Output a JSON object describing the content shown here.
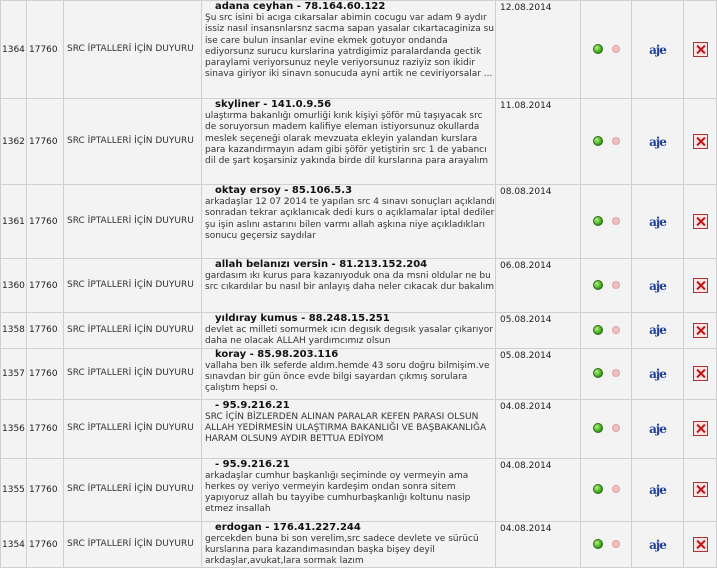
{
  "comments": [
    {
      "comment_id": "1364",
      "news_id": "17760",
      "subject": "SRC İPTALLERİ İÇİN DUYURU",
      "author": "adana ceyhan",
      "ip": "78.164.60.122",
      "date": "12.08.2014",
      "text": "Şu src isini bi acıga cıkarsalar abimin cocugu var adam 9 aydır issiz nasıl insansnlarsnz sacma sapan yasalar cıkartacaginiza su ise care bulun insanlar evine ekmek gotuyor ondanda ediyorsunz surucu kurslarina yatrdigimiz paralardanda gectik paraylami veriyorsunuz neyle veriyorsunuz raziyiz son ikidir sinava giriyor iki sinavn sonucuda ayni artik ne ceviriyorsalar ..."
    },
    {
      "comment_id": "1362",
      "news_id": "17760",
      "subject": "SRC İPTALLERİ İÇİN DUYURU",
      "author": "skyliner",
      "ip": "141.0.9.56",
      "date": "11.08.2014",
      "text": "ulaştırma bakanlığı omurliği kırık kişiyi şöför mü taşıyacak src de soruyorsun madem kalifiye eleman istiyorsunuz okullarda meslek seçeneği olarak mevzuata ekleyin yalandan kurslara para kazandırmayın adam gibi şöför yetiştirin src 1 de yabancı dil de şart koşarsiniz yakında birde dil kurslarına para arayalım"
    },
    {
      "comment_id": "1361",
      "news_id": "17760",
      "subject": "SRC İPTALLERİ İÇİN DUYURU",
      "author": "oktay ersoy",
      "ip": "85.106.5.3",
      "date": "08.08.2014",
      "text": "arkadaşlar 12 07 2014 te yapılan src 4 sınavı sonuçları açıklandı sonradan tekrar açıklanıcak dedi kurs o açıklamalar iptal dediler şu işin aslını astarını bilen varmı allah aşkına niye açıkladıkları sonucu geçersiz saydılar"
    },
    {
      "comment_id": "1360",
      "news_id": "17760",
      "subject": "SRC İPTALLERİ İÇİN DUYURU",
      "author": "allah belanızı versin",
      "ip": "81.213.152.204",
      "date": "06.08.2014",
      "text": "gardasım ıkı kurus para kazanıyoduk ona da msni oldular ne bu src cıkardılar bu nasıl bir anlayış daha neler cıkacak dur bakalım"
    },
    {
      "comment_id": "1358",
      "news_id": "17760",
      "subject": "SRC İPTALLERİ İÇİN DUYURU",
      "author": "yıldıray kumus",
      "ip": "88.248.15.251",
      "date": "05.08.2014",
      "text": "devlet ac milleti somurmek ıcın degısık degısık yasalar çıkarıyor daha ne olacak ALLAH yardımcımız olsun"
    },
    {
      "comment_id": "1357",
      "news_id": "17760",
      "subject": "SRC İPTALLERİ İÇİN DUYURU",
      "author": "koray",
      "ip": "85.98.203.116",
      "date": "05.08.2014",
      "text": "vallaha ben ilk seferde aldım.hemde 43 soru doğru bilmişim.ve sınavdan bir gün önce evde bilgi sayardan çıkmış sorulara çalıştım hepsi o."
    },
    {
      "comment_id": "1356",
      "news_id": "17760",
      "subject": "SRC İPTALLERİ İÇİN DUYURU",
      "author": "",
      "ip": "95.9.216.21",
      "date": "04.08.2014",
      "text": "SRC İÇİN BİZLERDEN ALINAN PARALAR KEFEN PARASI OLSUN ALLAH YEDİRMESİN ULAŞTIRMA BAKANLIĞI VE BAŞBAKANLIĞA HARAM OLSUN9 AYDIR BETTUA EDİYOM"
    },
    {
      "comment_id": "1355",
      "news_id": "17760",
      "subject": "SRC İPTALLERİ İÇİN DUYURU",
      "author": "",
      "ip": "95.9.216.21",
      "date": "04.08.2014",
      "text": "arkadaşlar cumhur başkanlığı seçiminde oy vermeyin ama herkes oy veriyo vermeyin kardeşim ondan sonra sitem yapıyoruz allah bu tayyibe cumhurbaşkanlığı koltunu nasip etmez insallah"
    },
    {
      "comment_id": "1354",
      "news_id": "17760",
      "subject": "SRC İPTALLERİ İÇİN DUYURU",
      "author": "erdogan",
      "ip": "176.41.227.244",
      "date": "04.08.2014",
      "text": "gercekden buna bi son verelim,src sadece devlete ve sürücü kurslarına para kazandımasından başka bişey deyil arkdaşlar,avukat,lara sormak lazım"
    }
  ],
  "icons": {
    "status_on": "green-dot-icon",
    "status_off": "pink-dot-icon",
    "edit": "ajax-edit-icon",
    "delete": "delete-icon"
  },
  "ajax_label": "aje"
}
